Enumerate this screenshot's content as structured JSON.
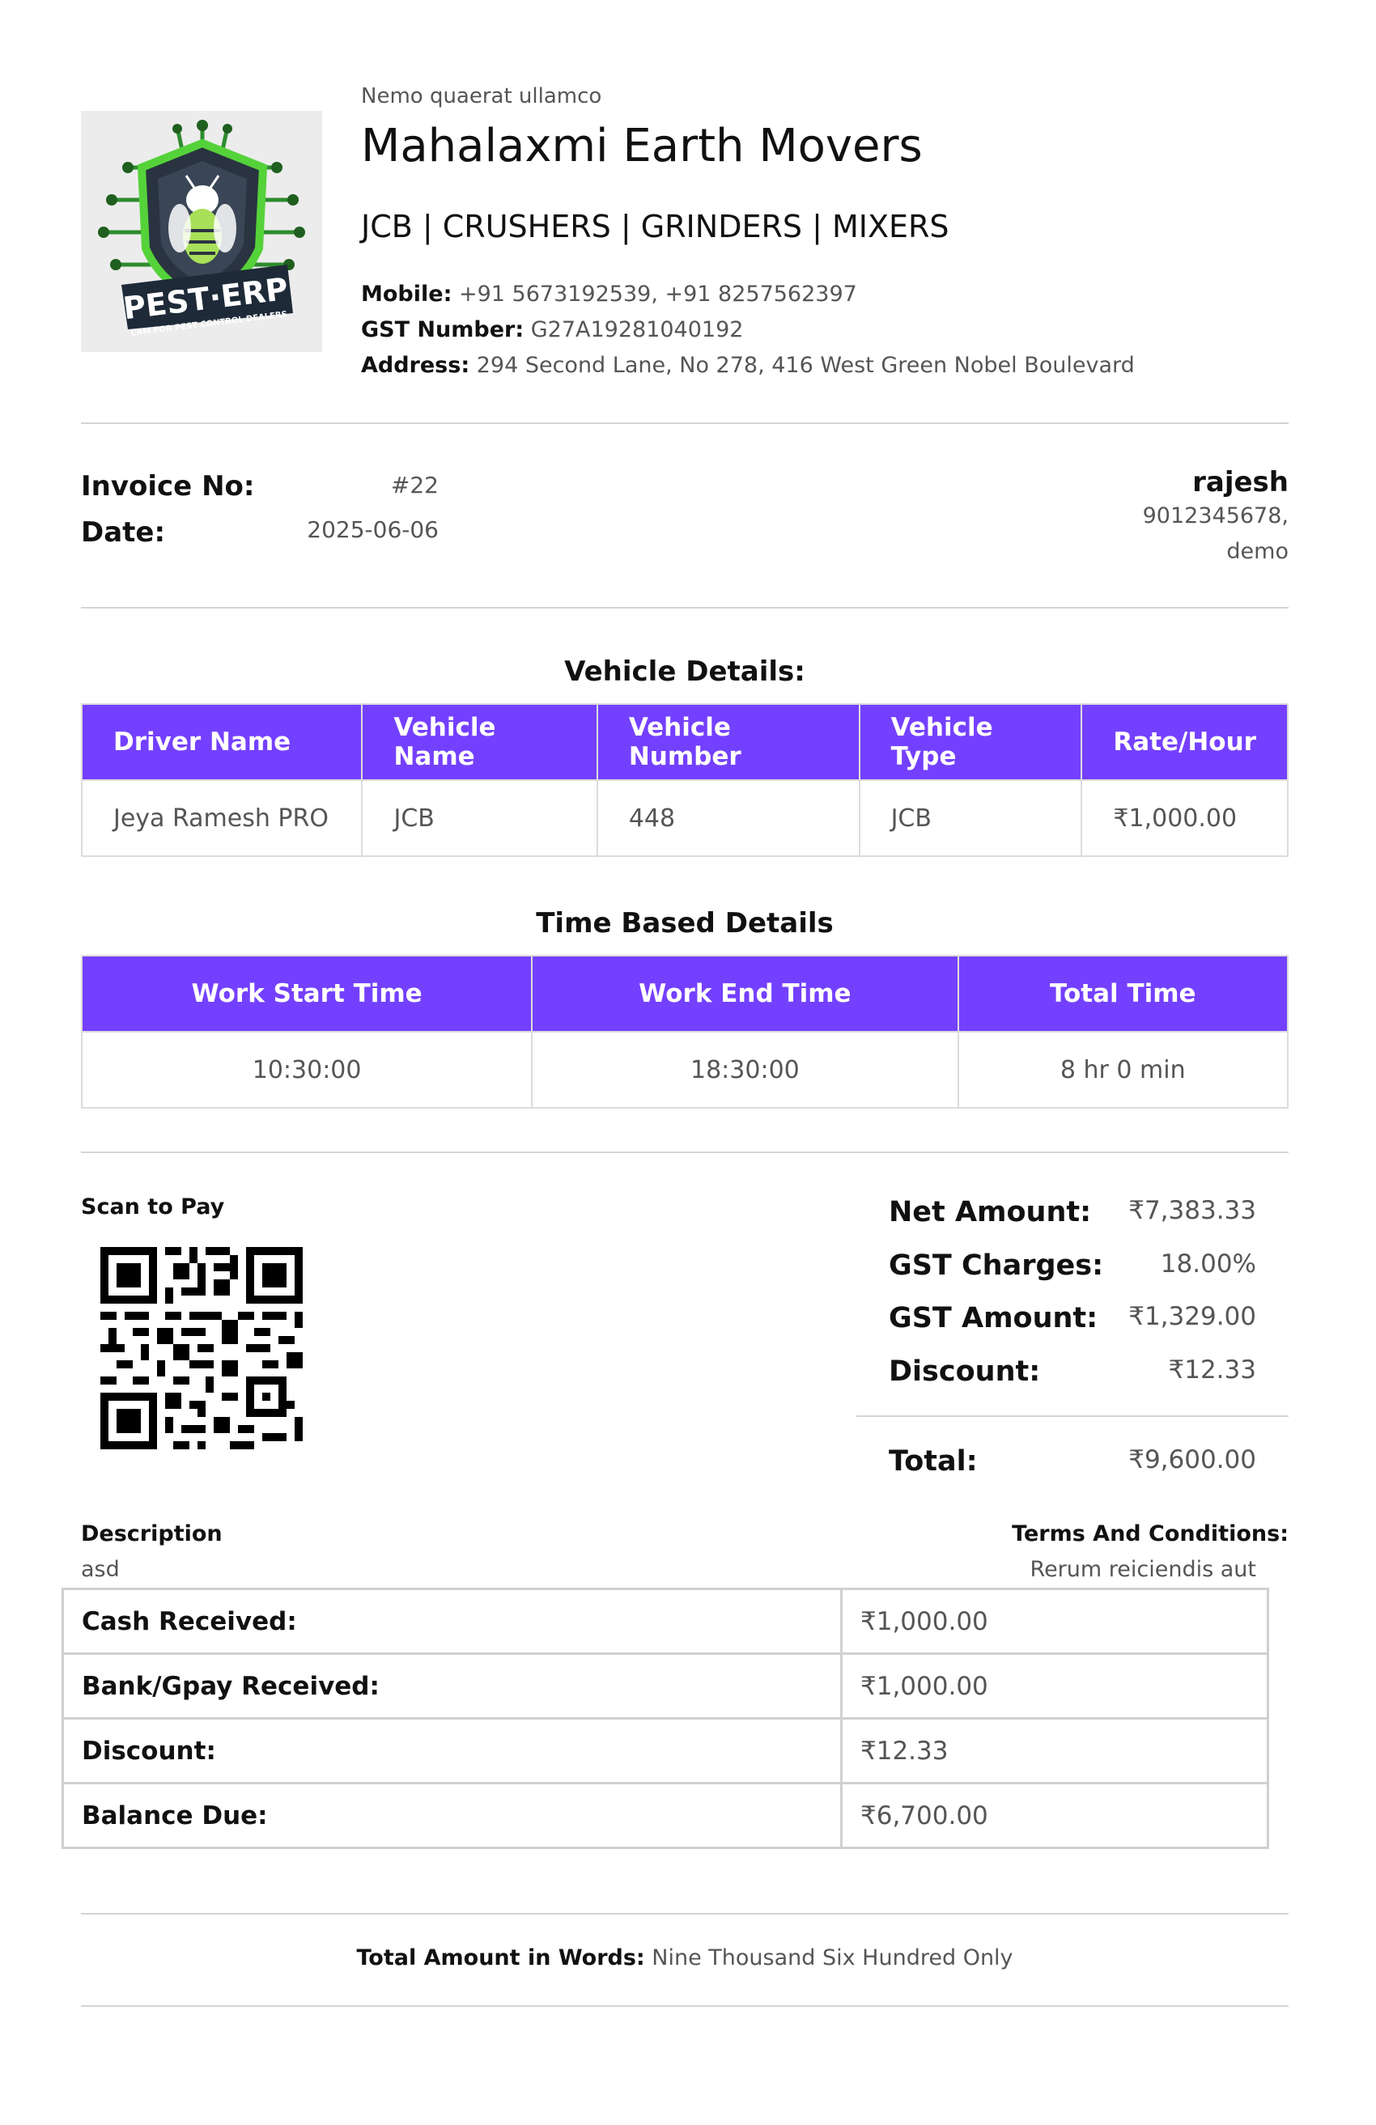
{
  "company": {
    "tagline": "Nemo quaerat ullamco",
    "name": "Mahalaxmi Earth Movers",
    "services": "JCB | CRUSHERS | GRINDERS | MIXERS",
    "mobile_label": "Mobile:",
    "mobile": "+91 5673192539, +91 8257562397",
    "gst_label": "GST Number:",
    "gst": "G27A19281040192",
    "address_label": "Address:",
    "address": "294 Second Lane, No 278, 416 West Green Nobel Boulevard"
  },
  "logo": {
    "title": "PEST·ERP",
    "subtitle": "CRM FOR PEST CONTROL DEALERS"
  },
  "invoice": {
    "no_label": "Invoice No:",
    "no": "#22",
    "date_label": "Date:",
    "date": "2025-06-06"
  },
  "customer": {
    "name": "rajesh",
    "phone": "9012345678,",
    "extra": "demo"
  },
  "vehicle": {
    "title": "Vehicle Details:",
    "headers": [
      "Driver Name",
      "Vehicle Name",
      "Vehicle Number",
      "Vehicle Type",
      "Rate/Hour"
    ],
    "row": [
      "Jeya Ramesh PRO",
      "JCB",
      "448",
      "JCB",
      "₹1,000.00"
    ]
  },
  "time": {
    "title": "Time Based Details",
    "headers": [
      "Work Start Time",
      "Work End Time",
      "Total Time"
    ],
    "row": [
      "10:30:00",
      "18:30:00",
      "8 hr 0 min"
    ]
  },
  "scan_label": "Scan to Pay",
  "totals": {
    "net_label": "Net Amount:",
    "net": "₹7,383.33",
    "gst_charges_label": "GST Charges:",
    "gst_charges": "18.00%",
    "gst_amount_label": "GST Amount:",
    "gst_amount": "₹1,329.00",
    "discount_label": "Discount:",
    "discount": "₹12.33",
    "total_label": "Total:",
    "total": "₹9,600.00"
  },
  "description": {
    "label": "Description",
    "value": "asd"
  },
  "terms": {
    "label": "Terms And Conditions:",
    "value": "Rerum reiciendis aut"
  },
  "payments": [
    {
      "label": "Cash Received:",
      "value": "₹1,000.00"
    },
    {
      "label": "Bank/Gpay Received:",
      "value": "₹1,000.00"
    },
    {
      "label": "Discount:",
      "value": "₹12.33"
    },
    {
      "label": "Balance Due:",
      "value": "₹6,700.00"
    }
  ],
  "words": {
    "label": "Total Amount in Words:",
    "value": "Nine Thousand Six Hundred Only"
  }
}
